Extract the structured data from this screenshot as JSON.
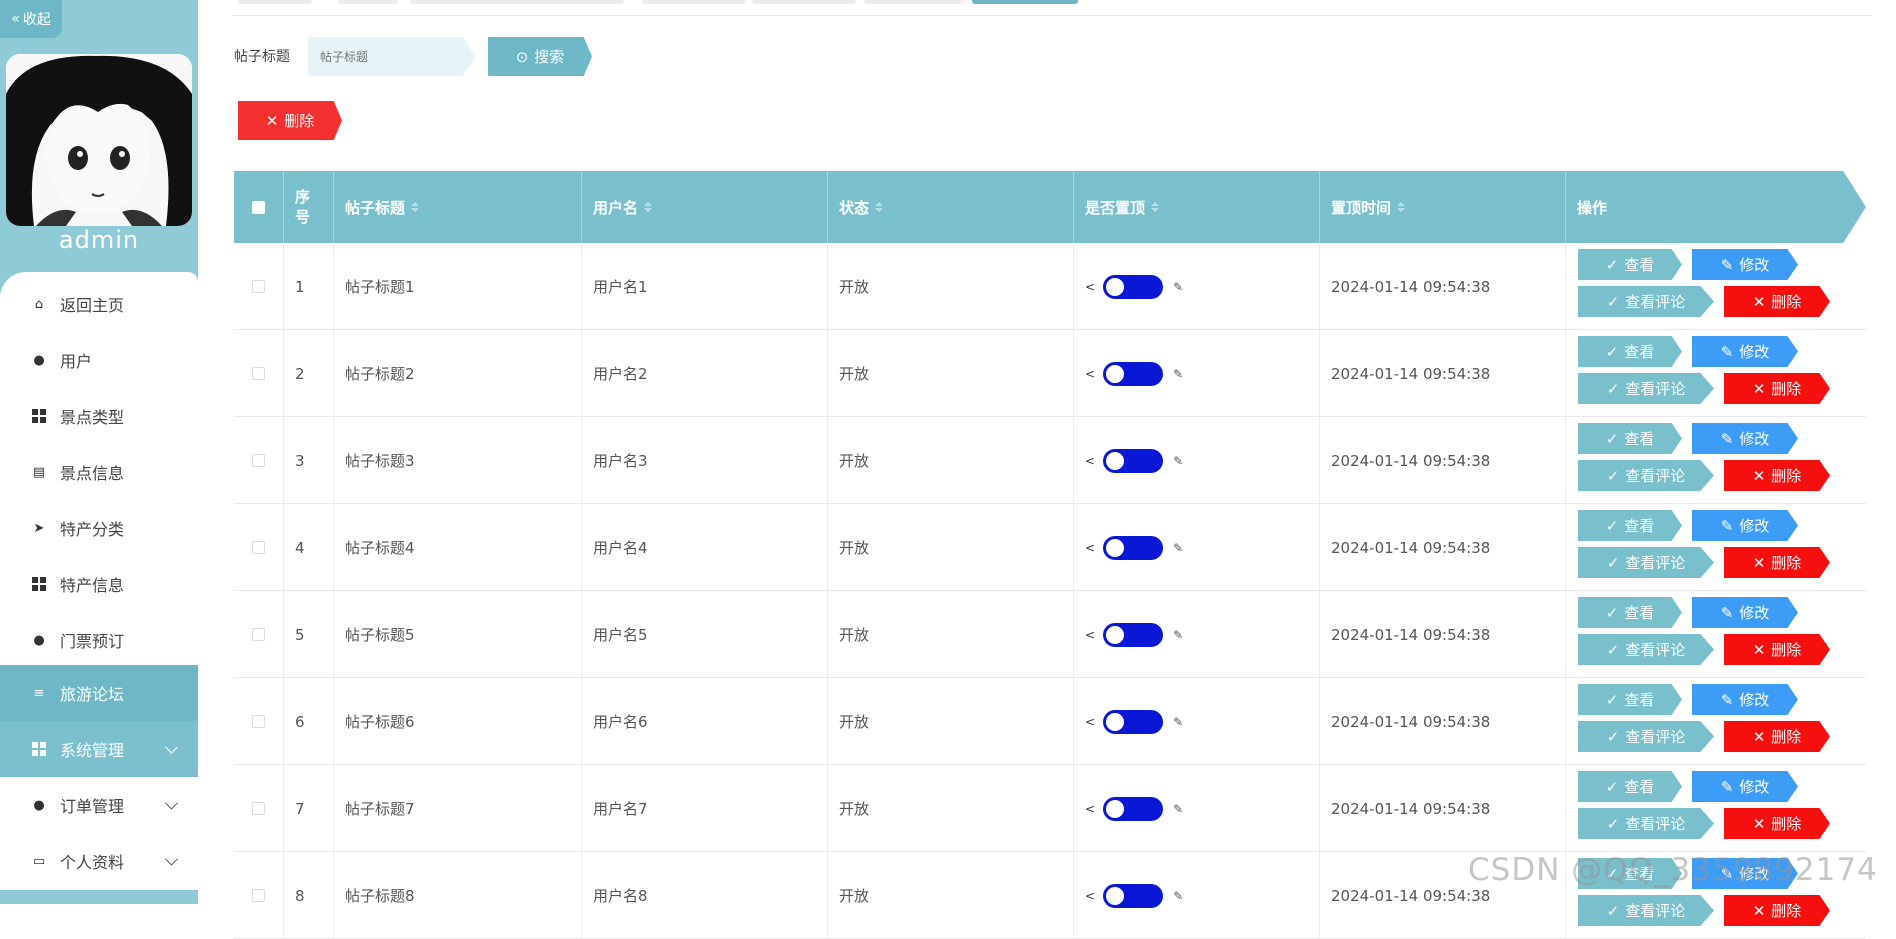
{
  "sidebar": {
    "collapse_label": "收起",
    "admin_name": "admin",
    "items": [
      {
        "label": "返回主页",
        "icon": "home-icon"
      },
      {
        "label": "用户",
        "icon": "user-icon"
      },
      {
        "label": "景点类型",
        "icon": "grid-icon"
      },
      {
        "label": "景点信息",
        "icon": "clipboard-icon"
      },
      {
        "label": "特产分类",
        "icon": "send-icon"
      },
      {
        "label": "特产信息",
        "icon": "grid-icon"
      },
      {
        "label": "门票预订",
        "icon": "person-icon"
      },
      {
        "label": "旅游论坛",
        "icon": "list-icon",
        "active": true
      },
      {
        "label": "系统管理",
        "icon": "grid-icon",
        "expandable": true,
        "hovered": true
      },
      {
        "label": "订单管理",
        "icon": "bulb-icon",
        "expandable": true
      },
      {
        "label": "个人资料",
        "icon": "card-icon",
        "expandable": true
      }
    ]
  },
  "search": {
    "label": "帖子标题",
    "placeholder": "帖子标题",
    "button_label": "搜索"
  },
  "toolbar": {
    "delete_label": "删除"
  },
  "table": {
    "columns": [
      "序号",
      "帖子标题",
      "用户名",
      "状态",
      "是否置顶",
      "置顶时间",
      "操作"
    ],
    "rows": [
      {
        "index": "1",
        "title": "帖子标题1",
        "username": "用户名1",
        "status": "开放",
        "pinned": true,
        "pin_time": "2024-01-14 09:54:38"
      },
      {
        "index": "2",
        "title": "帖子标题2",
        "username": "用户名2",
        "status": "开放",
        "pinned": true,
        "pin_time": "2024-01-14 09:54:38"
      },
      {
        "index": "3",
        "title": "帖子标题3",
        "username": "用户名3",
        "status": "开放",
        "pinned": true,
        "pin_time": "2024-01-14 09:54:38"
      },
      {
        "index": "4",
        "title": "帖子标题4",
        "username": "用户名4",
        "status": "开放",
        "pinned": true,
        "pin_time": "2024-01-14 09:54:38"
      },
      {
        "index": "5",
        "title": "帖子标题5",
        "username": "用户名5",
        "status": "开放",
        "pinned": true,
        "pin_time": "2024-01-14 09:54:38"
      },
      {
        "index": "6",
        "title": "帖子标题6",
        "username": "用户名6",
        "status": "开放",
        "pinned": true,
        "pin_time": "2024-01-14 09:54:38"
      },
      {
        "index": "7",
        "title": "帖子标题7",
        "username": "用户名7",
        "status": "开放",
        "pinned": true,
        "pin_time": "2024-01-14 09:54:38"
      },
      {
        "index": "8",
        "title": "帖子标题8",
        "username": "用户名8",
        "status": "开放",
        "pinned": true,
        "pin_time": "2024-01-14 09:54:38"
      }
    ],
    "actions": {
      "view": "查看",
      "edit": "修改",
      "comments": "查看评论",
      "delete": "删除"
    }
  },
  "colors": {
    "sidebar_bg": "#8ecbd6",
    "accent": "#6db7c6",
    "header_bg": "#79bfcc",
    "edit_blue": "#3d9cf5",
    "danger_red": "#f50f0f",
    "toggle_on": "#0a18d6"
  },
  "watermark": "CSDN @QQ_3359892174"
}
